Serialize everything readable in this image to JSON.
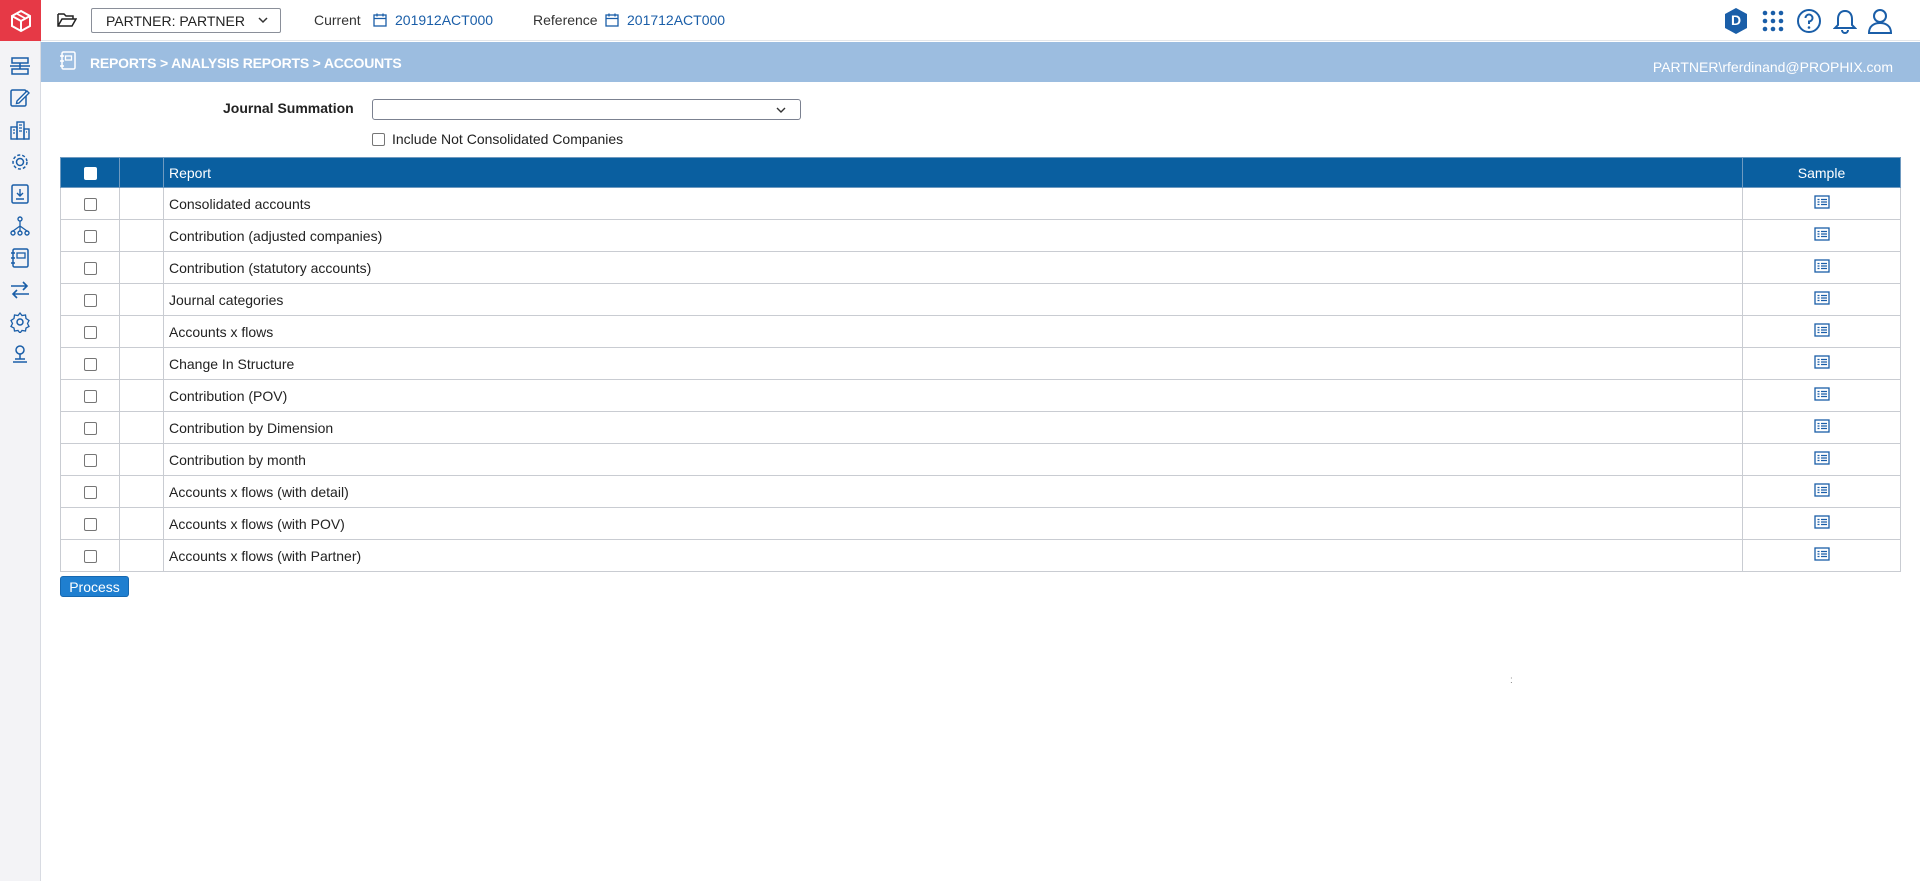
{
  "app": {
    "colors": {
      "brand": "#e63946",
      "header": "#0a5fa0",
      "crumb_bar": "#9cbde0",
      "link": "#1a5ea8",
      "button": "#1f7fd0"
    }
  },
  "rail": {
    "logo_icon": "cube-logo-icon",
    "icons": [
      "workflow-icon",
      "edit-icon",
      "companies-icon",
      "settings-gear-icon",
      "journal-download-icon",
      "hierarchy-icon",
      "reports-book-icon",
      "transfer-arrows-icon",
      "admin-gear-icon",
      "user-network-icon"
    ]
  },
  "topbar": {
    "partner_select": "PARTNER: PARTNER",
    "current_label": "Current",
    "current_value": "201912ACT000",
    "reference_label": "Reference",
    "reference_value": "201712ACT000",
    "avatar_letter": "D",
    "icons": [
      "apps-grid-icon",
      "help-icon",
      "bell-icon",
      "user-icon"
    ]
  },
  "breadcrumb": {
    "path": "REPORTS > ANALYSIS REPORTS > ACCOUNTS",
    "user": "PARTNER\\rferdinand@PROPHIX.com"
  },
  "form": {
    "journal_summation_label": "Journal Summation",
    "journal_summation_value": "",
    "include_label": "Include Not Consolidated Companies"
  },
  "table": {
    "headers": {
      "report": "Report",
      "sample": "Sample"
    },
    "rows": [
      {
        "report": "Consolidated accounts"
      },
      {
        "report": "Contribution (adjusted companies)"
      },
      {
        "report": "Contribution (statutory accounts)"
      },
      {
        "report": "Journal categories"
      },
      {
        "report": "Accounts x flows"
      },
      {
        "report": "Change In Structure"
      },
      {
        "report": "Contribution (POV)"
      },
      {
        "report": "Contribution by Dimension"
      },
      {
        "report": "Contribution by month"
      },
      {
        "report": "Accounts x flows (with detail)"
      },
      {
        "report": "Accounts x flows (with POV)"
      },
      {
        "report": "Accounts x flows (with Partner)"
      }
    ]
  },
  "actions": {
    "process_label": "Process"
  },
  "misc": {
    "dots": ":"
  }
}
